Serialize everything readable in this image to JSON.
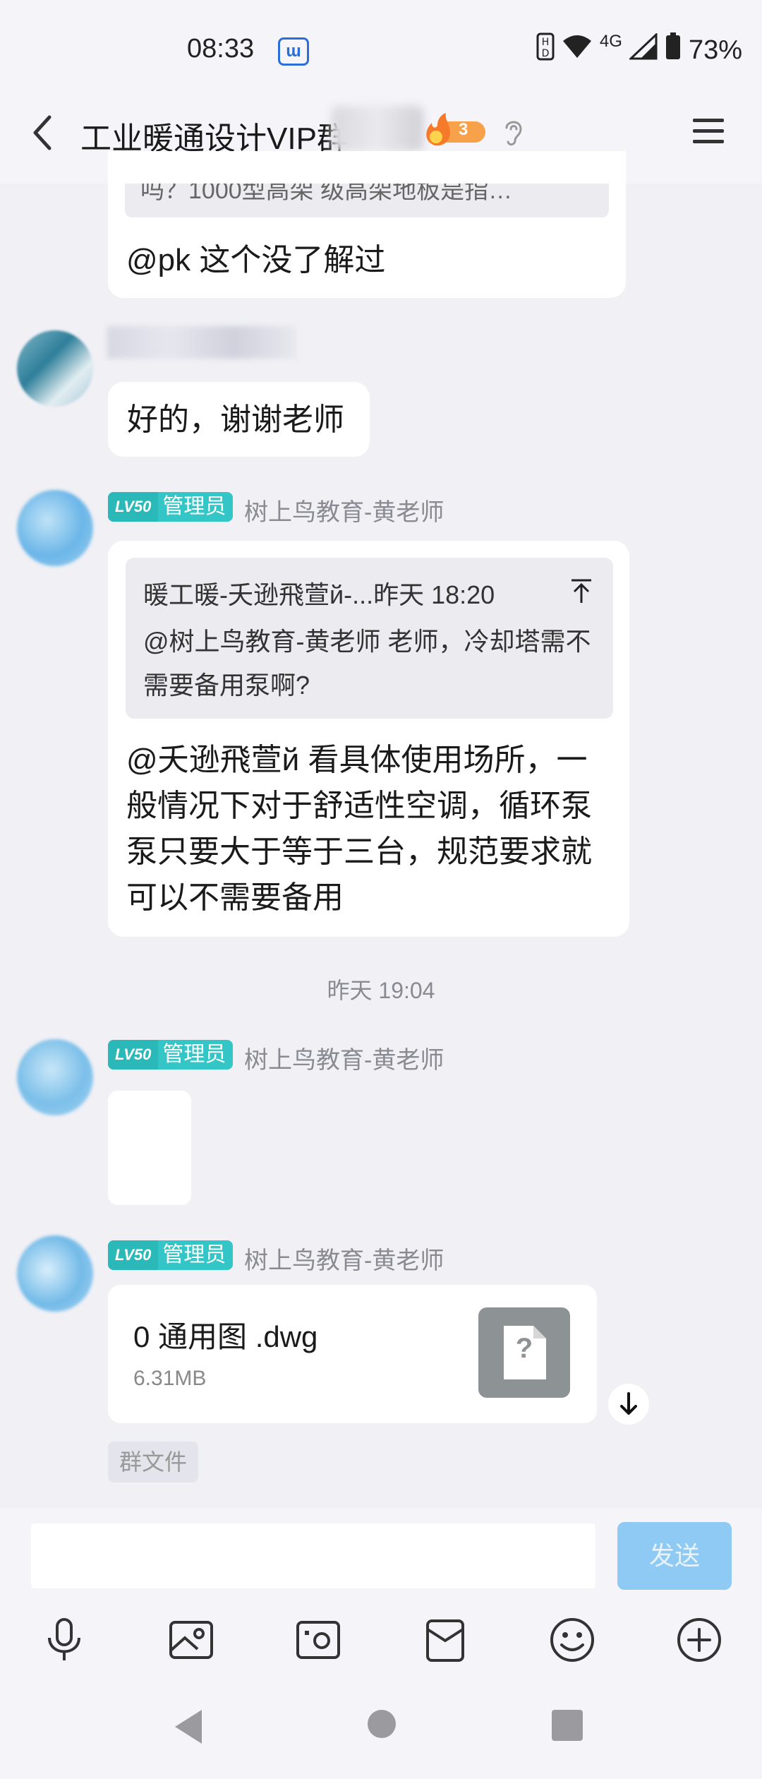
{
  "status_bar": {
    "time": "08:33",
    "network": "4G",
    "battery": "73%"
  },
  "header": {
    "title": "工业暖通设计VIP群",
    "fire_badge_count": "3"
  },
  "messages": {
    "m1": {
      "quote_text": "吗？1000型高架 级高架地板是指…",
      "text": "@pk 这个没了解过"
    },
    "m2": {
      "text": "好的，谢谢老师"
    },
    "m3": {
      "badge_level": "LV50",
      "badge_role": "管理员",
      "sender": "树上鸟教育-黄老师",
      "quote_header": "暖工暖-夭逊飛萱й-...昨天 18:20",
      "quote_body": "@树上鸟教育-黄老师 老师，冷却塔需不需要备用泵啊?",
      "text": "@夭逊飛萱й 看具体使用场所，一般情况下对于舒适性空调，循环泵泵只要大于等于三台，规范要求就可以不需要备用"
    },
    "timestamp": "昨天 19:04",
    "m4": {
      "badge_level": "LV50",
      "badge_role": "管理员",
      "sender": "树上鸟教育-黄老师"
    },
    "m5": {
      "badge_level": "LV50",
      "badge_role": "管理员",
      "sender": "树上鸟教育-黄老师",
      "file_name": "0 通用图 .dwg",
      "file_size": "6.31MB",
      "file_icon_glyph": "?",
      "file_tag": "群文件"
    }
  },
  "composer": {
    "input_value": "",
    "send_label": "发送"
  },
  "colors": {
    "accent": "#34c6c6",
    "send_button": "#8fcaf5",
    "background": "#f0f0f5"
  }
}
